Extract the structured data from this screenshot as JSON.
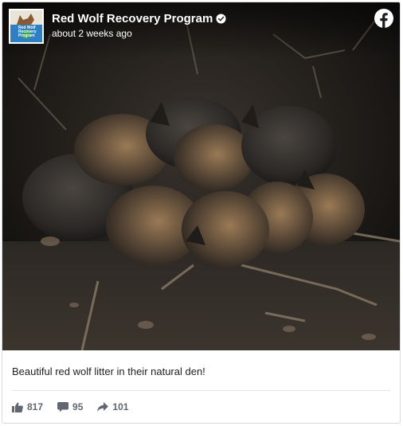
{
  "post": {
    "page_name": "Red Wolf Recovery Program",
    "timestamp": "about 2 weeks ago",
    "verified": true,
    "caption": "Beautiful red wolf litter in their natural den!",
    "avatar_text": "Red Wolf Recovery Program"
  },
  "stats": {
    "likes": "817",
    "comments": "95",
    "shares": "101"
  },
  "icons": {
    "like": "thumbs-up-icon",
    "comment": "comment-bubble-icon",
    "share": "share-arrow-icon",
    "brand": "facebook-logo-icon",
    "verified": "verified-badge-icon"
  },
  "colors": {
    "stat_text": "#606770",
    "caption_text": "#1c1e21",
    "avatar_bg": "#2f7fc2"
  }
}
